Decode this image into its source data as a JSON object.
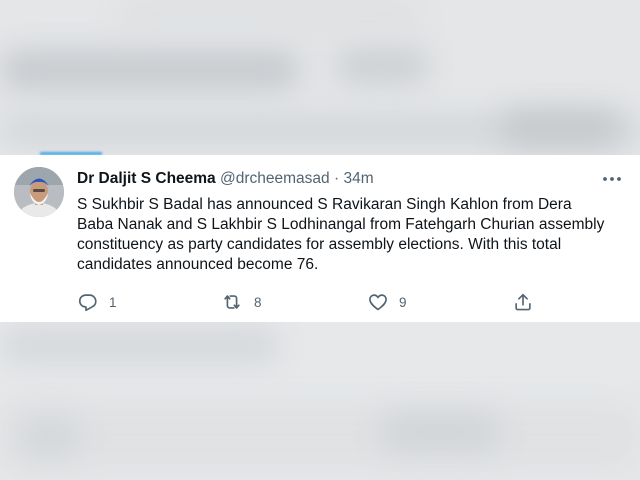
{
  "tweet": {
    "author_name": "Dr Daljit S Cheema",
    "handle": "@drcheemasad",
    "separator": "·",
    "time": "34m",
    "text_lines": [
      "S Sukhbir S Badal has announced S Ravikaran Singh Kahlon from Dera",
      "Baba Nanak and S Lakhbir S Lodhinangal from Fatehgarh Churian assembly",
      "constituency as party candidates for assembly elections. With this total",
      "candidates announced become 76."
    ],
    "replies": "1",
    "retweets": "8",
    "likes": "9"
  },
  "icons": {
    "more": "more-horizontal-icon",
    "reply": "reply-icon",
    "retweet": "retweet-icon",
    "like": "heart-icon",
    "share": "share-icon"
  },
  "colors": {
    "name": "#0f1419",
    "secondary": "#536471",
    "accent": "#1d9bf0",
    "card_background": "#ffffff",
    "page_background": "#e9ebed"
  }
}
